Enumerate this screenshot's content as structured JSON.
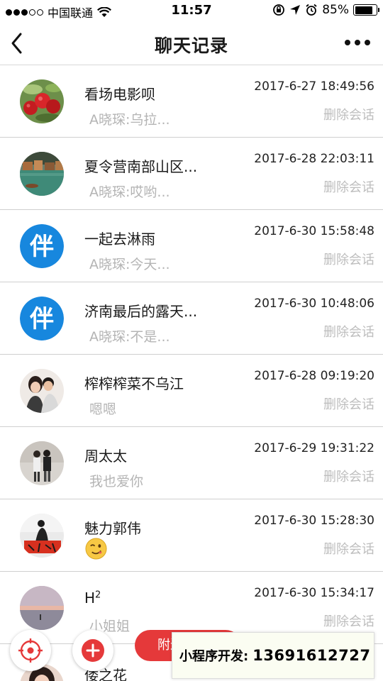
{
  "status_bar": {
    "carrier": "中国联通",
    "time": "11:57",
    "battery": "85%",
    "battery_level": 0.85,
    "signal_bars_filled": 3,
    "signal_bars_total": 5
  },
  "nav": {
    "title": "聊天记录",
    "back_icon": "chevron-left-icon",
    "more_icon": "more-dots-icon"
  },
  "chats": [
    {
      "name": "看场电影呗",
      "preview": "A晓琛:乌拉...",
      "time": "2017-6-27 18:49:56",
      "delete": "删除会话",
      "avatar": "apples-photo"
    },
    {
      "name": "夏令营南部山区...",
      "preview": "A晓琛:哎哟...",
      "time": "2017-6-28 22:03:11",
      "delete": "删除会话",
      "avatar": "lake-town-photo"
    },
    {
      "name": "一起去淋雨",
      "preview": "A晓琛:今天...",
      "time": "2017-6-30 15:58:48",
      "delete": "删除会话",
      "avatar": "partner-logo",
      "avatar_text": "伴"
    },
    {
      "name": "济南最后的露天...",
      "preview": "A晓琛:不是...",
      "time": "2017-6-30 10:48:06",
      "delete": "删除会话",
      "avatar": "partner-logo",
      "avatar_text": "伴"
    },
    {
      "name": "榨榨榨菜不乌江",
      "preview": "嗯嗯",
      "time": "2017-6-28 09:19:20",
      "delete": "删除会话",
      "avatar": "couple-photo"
    },
    {
      "name": "周太太",
      "preview": "我也爱你",
      "time": "2017-6-29 19:31:22",
      "delete": "删除会话",
      "avatar": "couple-standing-photo"
    },
    {
      "name": "魅力郭伟",
      "preview": "",
      "time": "2017-6-30 15:28:30",
      "delete": "删除会话",
      "avatar": "calligraphy-photo",
      "preview_icon": "wink-emoji-icon"
    },
    {
      "name": "H",
      "name_sup": "2",
      "preview": "小姐姐",
      "time": "2017-6-30 15:34:17",
      "delete": "删除会话",
      "avatar": "sunset-photo"
    }
  ],
  "last_chat": {
    "name": "倭之花",
    "avatar": "woman-photo"
  },
  "floating": {
    "locate_icon": "locate-icon",
    "add_icon": "plus-icon",
    "nearby_label": "附近",
    "accent": "#e5393a"
  },
  "promo": {
    "label": "小程序开发:",
    "phone": "13691612727"
  },
  "colors": {
    "partner_blue": "#1787de",
    "divider": "#cfcfcf",
    "muted_text": "#b4b4b4"
  }
}
